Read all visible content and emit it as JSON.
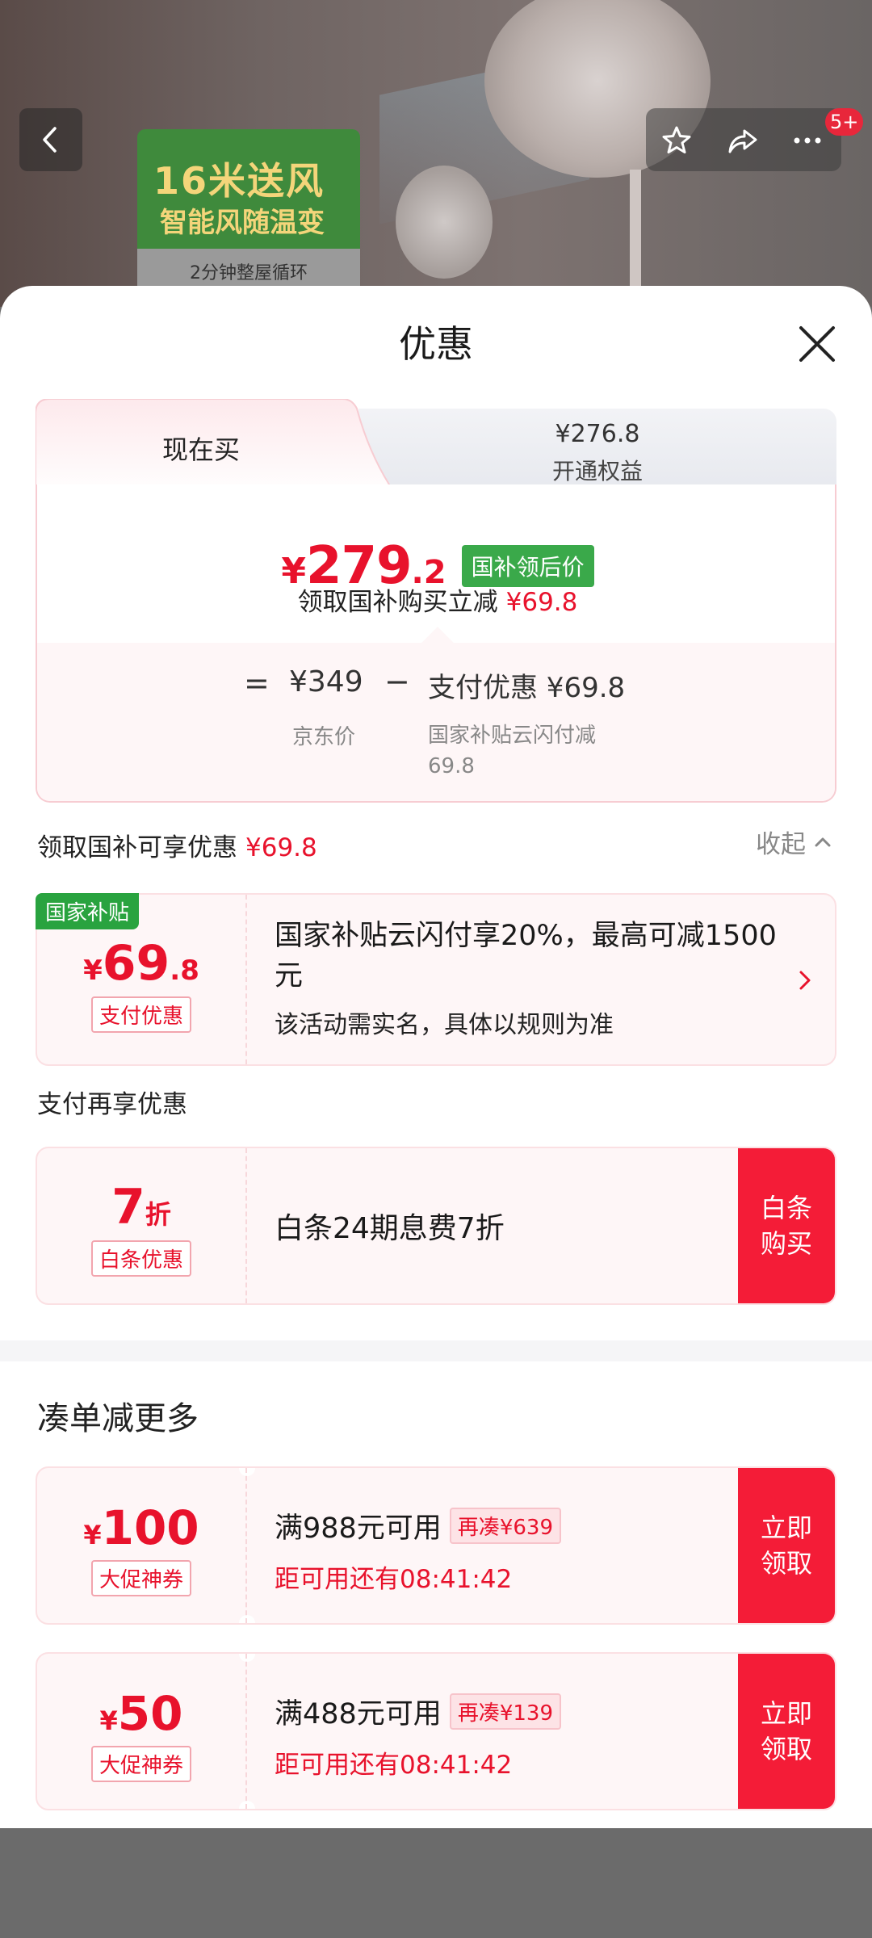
{
  "hero": {
    "card_title_1": "16米送风",
    "card_title_2": "智能风随温变",
    "card_sub": "2分钟整屋循环",
    "more_badge": "5+"
  },
  "sheet": {
    "title": "优惠"
  },
  "tabs": {
    "active_label": "现在买",
    "inactive_price": "¥276.8",
    "inactive_label": "开通权益"
  },
  "price": {
    "yen": "¥",
    "integer": "279",
    "decimal": ".2",
    "tag": "国补领后价",
    "claim_text": "领取国补购买立减",
    "claim_amount": "¥69.8"
  },
  "calc": {
    "equals": "=",
    "jd_price": "¥349",
    "jd_price_label": "京东价",
    "minus": "−",
    "pay_discount": "支付优惠 ¥69.8",
    "pay_discount_label": "国家补贴云闪付减69.8"
  },
  "subsidy_section": {
    "title": "领取国补可享优惠",
    "amount": "¥69.8",
    "collapse_label": "收起",
    "badge": "国家补贴",
    "coupon": {
      "yen": "¥",
      "value": "69",
      "decimal": ".8",
      "tag": "支付优惠",
      "line1": "国家补贴云闪付享20%，最高可减1500元",
      "line2": "该活动需实名，具体以规则为准"
    }
  },
  "pay_section": {
    "title": "支付再享优惠",
    "coupon": {
      "value": "7",
      "unit": "折",
      "tag": "白条优惠",
      "text": "白条24期息费7折",
      "button": "白条购买"
    }
  },
  "more_section": {
    "title": "凑单减更多",
    "coupons": [
      {
        "yen": "¥",
        "value": "100",
        "tag": "大促神券",
        "condition": "满988元可用",
        "extra": "再凑¥639",
        "countdown": "距可用还有08:41:42",
        "button": "立即领取"
      },
      {
        "yen": "¥",
        "value": "50",
        "tag": "大促神券",
        "condition": "满488元可用",
        "extra": "再凑¥139",
        "countdown": "距可用还有08:41:42",
        "button": "立即领取"
      }
    ]
  },
  "colors": {
    "accent_red": "#e8122c",
    "button_red": "#f41c37",
    "subsidy_green": "#29a33f",
    "price_tag_green": "#3aa94a"
  }
}
